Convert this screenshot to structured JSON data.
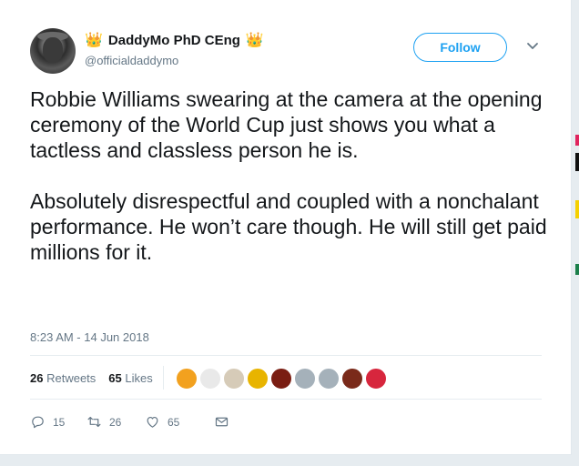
{
  "author": {
    "display_name": "DaddyMo PhD CEng",
    "handle": "@officialdaddymo",
    "avatar_icon": "profile-photo",
    "crown_icon": "crown-emoji",
    "crown_glyph": "👑"
  },
  "follow_label": "Follow",
  "tweet_text": "Robbie Williams swearing at the camera at the opening ceremony of the World Cup just shows you what a tactless and classless person he is.\n\nAbsolutely disrespectful and coupled with a nonchalant performance. He won’t care though. He will still get paid millions for it.",
  "timestamp": "8:23 AM - 14 Jun 2018",
  "stats": {
    "retweets_count": "26",
    "retweets_label": "Retweets",
    "likes_count": "65",
    "likes_label": "Likes"
  },
  "liker_avatars": [
    {
      "color": "#f2a11f",
      "icon": "infinity-avatar"
    },
    {
      "color": "#e9e9e9",
      "icon": "text-avatar"
    },
    {
      "color": "#d6cbb8",
      "icon": "script-avatar"
    },
    {
      "color": "#e8b400",
      "icon": "emoji-avatar"
    },
    {
      "color": "#7a1d12",
      "icon": "photo-avatar"
    },
    {
      "color": "#a5b1ba",
      "icon": "default-avatar"
    },
    {
      "color": "#a5b1ba",
      "icon": "default-avatar"
    },
    {
      "color": "#7a2a1a",
      "icon": "photo-avatar"
    },
    {
      "color": "#d7263d",
      "icon": "badge-avatar"
    }
  ],
  "actions": {
    "reply_count": "15",
    "retweet_count": "26",
    "like_count": "65"
  },
  "colors": {
    "accent": "#1da1f2",
    "text": "#14171a",
    "muted": "#657786"
  }
}
